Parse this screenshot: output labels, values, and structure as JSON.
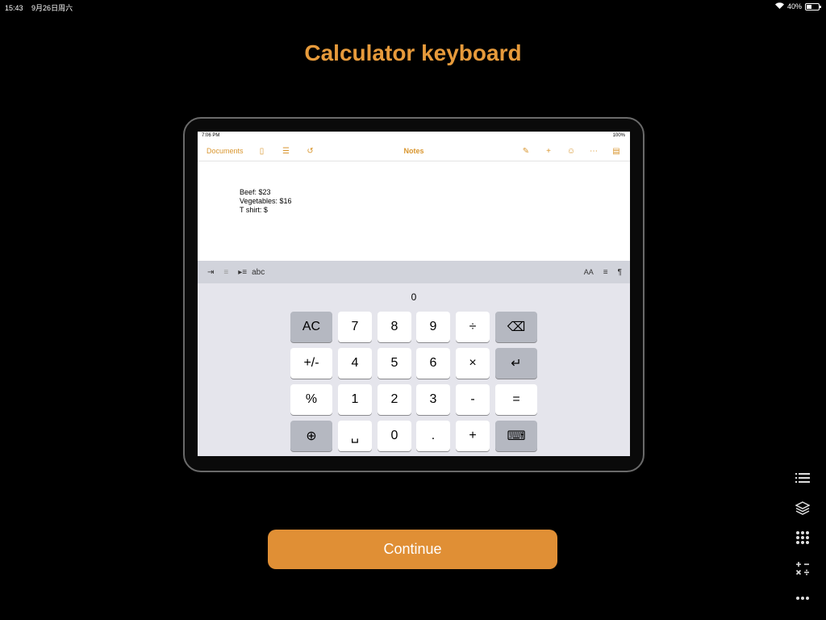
{
  "status_bar": {
    "time": "15:43",
    "date": "9月26日周六",
    "battery": "40%",
    "battery_level": 0.4
  },
  "title": "Calculator keyboard",
  "device": {
    "status": {
      "time": "7:06 PM",
      "battery": "100%"
    },
    "toolbar": {
      "documents": "Documents",
      "title": "Notes"
    },
    "note_lines": [
      "Beef: $23",
      "Vegetables: $16",
      "",
      "T shirt: $"
    ],
    "format_bar": {
      "abc": "abc",
      "text_size": "AA"
    },
    "calculator": {
      "display": "0",
      "keys": {
        "ac": "AC",
        "seven": "7",
        "eight": "8",
        "nine": "9",
        "divide": "÷",
        "plusminus": "+/-",
        "four": "4",
        "five": "5",
        "six": "6",
        "multiply": "×",
        "percent": "%",
        "one": "1",
        "two": "2",
        "three": "3",
        "minus": "-",
        "equals": "=",
        "space": "␣",
        "zero": "0",
        "dot": ".",
        "plus": "+"
      }
    }
  },
  "continue_label": "Continue",
  "side_icons": [
    "list-icon",
    "layers-icon",
    "grid-icon",
    "math-ops-icon",
    "more-icon"
  ],
  "colors": {
    "accent": "#e69a3b",
    "button": "#e08f35"
  }
}
